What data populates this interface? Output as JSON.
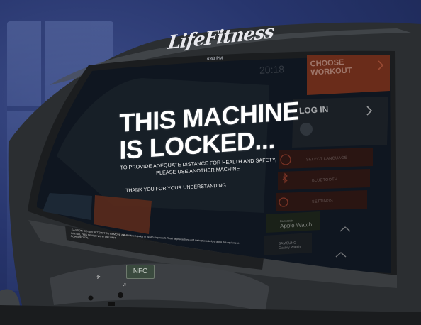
{
  "console": {
    "brand": "LifeFitness",
    "clock": "4:43 PM",
    "ghost_timer": "20:18"
  },
  "lock_screen": {
    "title_line1": "THIS MACHINE",
    "title_line2": "IS LOCKED...",
    "message_line1": "TO PROVIDE ADEQUATE DISTANCE FOR HEALTH AND SAFETY,",
    "message_line2": "PLEASE USE ANOTHER MACHINE.",
    "thanks": "THANK YOU FOR YOUR UNDERSTANDING"
  },
  "menu": {
    "choose_workout_line1": "CHOOSE",
    "choose_workout_line2": "WORKOUT",
    "log_in": "LOG IN",
    "select_language": "SELECT LANGUAGE",
    "bluetooth": "BLUETOOTH",
    "settings": "SETTINGS",
    "apple_watch_connect": "Connect to",
    "apple_watch": "Apple Watch",
    "samsung": "SAMSUNG",
    "galaxy_watch": "Galaxy Watch"
  },
  "hardware": {
    "nfc": "NFC",
    "caution": "CAUTION: DO NOT ATTEMPT TO REMOVE OR INSTALL THIS DEVICE WITH THE UNIT POWERED ON.",
    "warning": "WARNING: Injuries to health may result. Read all precautions and instructions before using this equipment."
  },
  "colors": {
    "accent": "#d9562c",
    "screen_bg": "#0f1620",
    "bezel": "#2e3134",
    "background": "#27356d"
  },
  "icons": {
    "choose_arrow": "chevron-right-icon",
    "login_arrow": "chevron-right-icon",
    "user": "user-icon",
    "globe": "globe-icon",
    "bluetooth": "bluetooth-icon",
    "settings": "gear-icon",
    "usb": "usb-icon",
    "headphone": "headphone-icon"
  }
}
